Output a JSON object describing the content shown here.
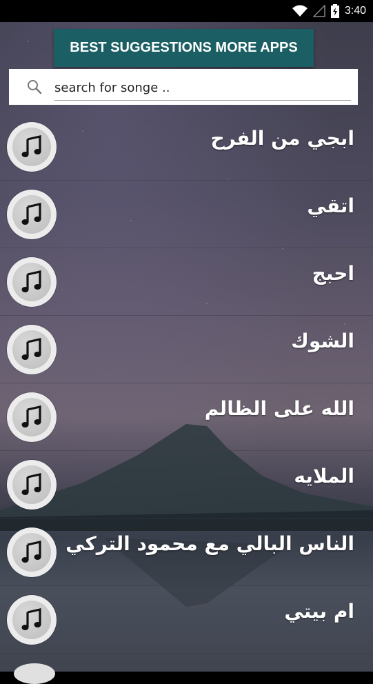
{
  "status_bar": {
    "time": "3:40",
    "icons": [
      "wifi-icon",
      "signal-icon",
      "battery-icon"
    ]
  },
  "top_button": {
    "label": "BEST SUGGESTIONS MORE APPS",
    "color": "#1b5f65"
  },
  "search": {
    "placeholder": "search for songe .."
  },
  "songs": [
    {
      "title": "ابجي من الفرح"
    },
    {
      "title": "اتقي"
    },
    {
      "title": "احبج"
    },
    {
      "title": "الشوك"
    },
    {
      "title": "الله على الظالم"
    },
    {
      "title": "الملايه"
    },
    {
      "title": "الناس البالي مع محمود التركي"
    },
    {
      "title": "ام بيتي"
    }
  ],
  "song_icon": "music-note-icon"
}
